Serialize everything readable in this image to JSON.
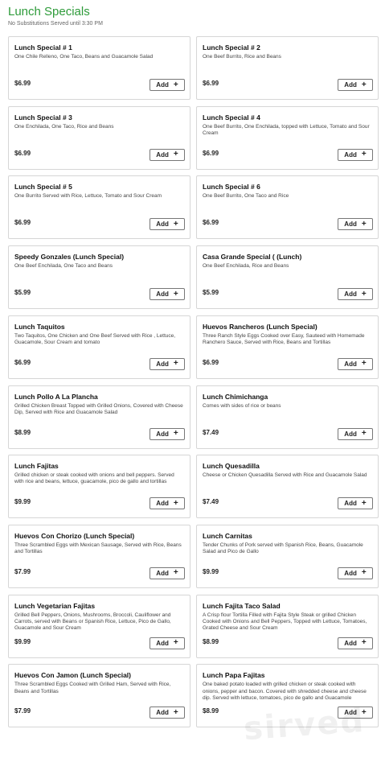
{
  "header": {
    "title": "Lunch Specials",
    "subtitle": "No Substitutions Served until 3:30 PM"
  },
  "add_label": "Add",
  "watermark": "sirved",
  "items": [
    {
      "name": "Lunch Special # 1",
      "desc": "One Chile Relleno, One Taco, Beans and Guacamole Salad",
      "price": "$6.99"
    },
    {
      "name": "Lunch Special # 2",
      "desc": "One Beef Burrito, Rice and Beans",
      "price": "$6.99"
    },
    {
      "name": "Lunch Special # 3",
      "desc": "One Enchilada, One Taco, Rice and Beans",
      "price": "$6.99"
    },
    {
      "name": "Lunch Special # 4",
      "desc": "One Beef Burrito, One Enchilada, topped with Lettuce, Tomato and Sour Cream",
      "price": "$6.99"
    },
    {
      "name": "Lunch Special # 5",
      "desc": "One Burrito Served with Rice, Lettuce, Tomato and Sour Cream",
      "price": "$6.99"
    },
    {
      "name": "Lunch Special # 6",
      "desc": "One Beef Burrito, One Taco and Rice",
      "price": "$6.99"
    },
    {
      "name": "Speedy Gonzales (Lunch Special)",
      "desc": "One Beef Enchilada, One Taco and Beans",
      "price": "$5.99"
    },
    {
      "name": "Casa Grande Special ( (Lunch)",
      "desc": "One Beef Enchilada, Rice and Beans",
      "price": "$5.99"
    },
    {
      "name": "Lunch Taquitos",
      "desc": "Two Taquitos, One Chicken and One Beef Served with Rice , Lettuce, Guacamole, Sour Cream and tomato",
      "price": "$6.99"
    },
    {
      "name": "Huevos Rancheros (Lunch Special)",
      "desc": "Three Ranch Style Eggs Cooked over Easy, Sauteed with Homemade Ranchero Sauce, Served with Rice, Beans and Tortillas",
      "price": "$6.99"
    },
    {
      "name": "Lunch Pollo A La Plancha",
      "desc": "Grilled Chicken Breast Topped with Grilled Onions, Covered with Cheese Dip, Served with Rice and Guacamole Salad",
      "price": "$8.99"
    },
    {
      "name": "Lunch Chimichanga",
      "desc": "Comes with sides of rice or beans",
      "price": "$7.49"
    },
    {
      "name": "Lunch Fajitas",
      "desc": "Grilled chicken or steak cooked with onions and bell peppers. Served with rice and beans, lettuce, guacamole, pico de gallo and tortillas",
      "price": "$9.99"
    },
    {
      "name": "Lunch Quesadilla",
      "desc": "Cheese or Chicken Quesadilla Served with Rice and Guacamole Salad",
      "price": "$7.49"
    },
    {
      "name": "Huevos Con Chorizo (Lunch Special)",
      "desc": "Three Scrambled Eggs with Mexican Sausage, Served with Rice, Beans and Tortillas",
      "price": "$7.99"
    },
    {
      "name": "Lunch Carnitas",
      "desc": "Tender Chunks of Pork served with Spanish Rice, Beans, Guacamole Salad and Pico de Gallo",
      "price": "$9.99"
    },
    {
      "name": "Lunch Vegetarian Fajitas",
      "desc": "Grilled Bell Peppers, Onions, Mushrooms, Broccoli, Cauliflower and Carrots, served with Beans or Spanish Rice, Lettuce, Pico de Gallo, Guacamole and Sour Cream",
      "price": "$9.99"
    },
    {
      "name": "Lunch Fajita Taco Salad",
      "desc": "A Crisp flour Tortilla Filled with Fajita Style Steak or grilled Chicken Cooked with Onions and Bell Peppers, Topped with Lettuce, Tomatoes, Grated Cheese and Sour Cream",
      "price": "$8.99"
    },
    {
      "name": "Huevos Con Jamon (Lunch Special)",
      "desc": "Three Scrambled Eggs Cooked with Grilled Ham, Served with Rice, Beans and Tortillas",
      "price": "$7.99"
    },
    {
      "name": "Lunch Papa Fajitas",
      "desc": "One baked potato loaded with grilled chicken or steak cooked with onions, pepper and bacon. Covered with shredded cheese and cheese dip. Served with lettuce, tomatoes, pico de gallo and Guacamole",
      "price": "$8.99"
    }
  ]
}
